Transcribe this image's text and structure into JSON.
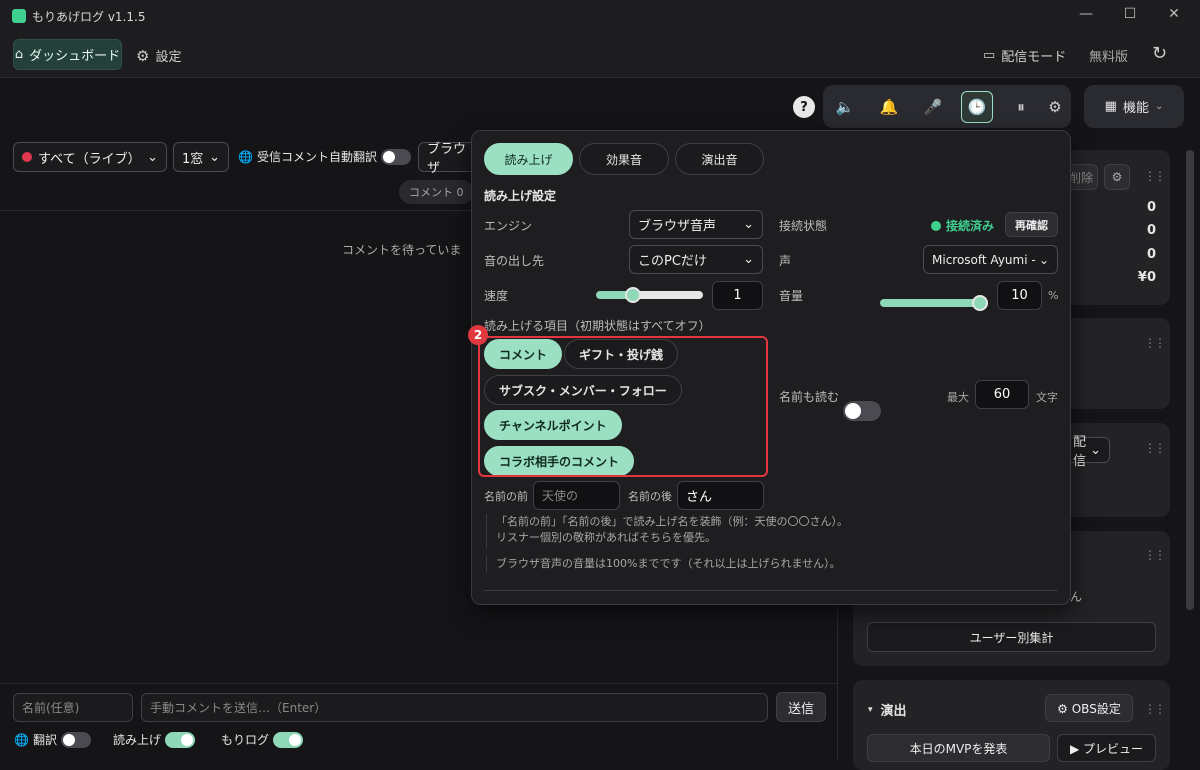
{
  "app": {
    "title": "もりあげログ  v1.1.5"
  },
  "nav": {
    "dashboard": "ダッシュボード",
    "settings": "設定",
    "stream_mode": "配信モード",
    "free_plan": "無料版"
  },
  "toolbar": {
    "help": "?",
    "features": "機能"
  },
  "filters": {
    "source": "すべて（ライブ）",
    "window": "1窓",
    "auto_translate": "受信コメント自動翻訳",
    "auto_translate_on": false,
    "browser_select": "ブラウザ",
    "comment_count": "コメント 0"
  },
  "comments": {
    "empty": "コメントを待っていま"
  },
  "bottom": {
    "name_placeholder": "名前(任意)",
    "comment_placeholder": "手動コメントを送信…（Enter）",
    "send": "送信",
    "translate_label": "翻訳",
    "translate_on": false,
    "read_label": "読み上げ",
    "read_on": true,
    "morilog_label": "もりログ",
    "morilog_on": true
  },
  "right_cards": {
    "delete_partial": "削除",
    "stats": [
      "0",
      "0",
      "0",
      "¥0"
    ],
    "haishin_partial": "配信",
    "san_partial": "ん",
    "user_stats": "ユーザー別集計",
    "effects_title": "演出",
    "obs_settings": "⚙ OBS設定",
    "mvp": "本日のMVPを発表",
    "preview": "▶ プレビュー"
  },
  "popup": {
    "tabs": [
      "読み上げ",
      "効果音",
      "演出音"
    ],
    "active_tab": 0,
    "section_title": "読み上げ設定",
    "engine_label": "エンジン",
    "engine_value": "ブラウザ音声",
    "output_label": "音の出し先",
    "output_value": "このPCだけ",
    "speed_label": "速度",
    "speed_value": "1",
    "speed_level": 0.35,
    "connection_label": "接続状態",
    "connection_value": "接続済み",
    "recheck": "再確認",
    "voice_label": "声",
    "voice_value": "Microsoft Ayumi -",
    "volume_label": "音量",
    "volume_value": "10",
    "volume_unit": "%",
    "volume_level": 1.0,
    "items_label": "読み上げる項目（初期状態はすべてオフ）",
    "badge": "2",
    "chips": [
      {
        "label": "コメント",
        "on": true
      },
      {
        "label": "ギフト・投げ銭",
        "on": false
      },
      {
        "label": "サブスク・メンバー・フォロー",
        "on": false
      },
      {
        "label": "チャンネルポイント",
        "on": true
      },
      {
        "label": "コラボ相手のコメント",
        "on": true
      }
    ],
    "read_name_label": "名前も読む",
    "read_name_on": false,
    "max_label": "最大",
    "max_value": "60",
    "max_unit": "文字",
    "name_before_label": "名前の前",
    "name_before_placeholder": "天使の",
    "name_after_label": "名前の後",
    "name_after_value": "さん",
    "note1a": "「名前の前」「名前の後」で読み上げ名を装飾（例：天使の〇〇さん）。",
    "note1b": "リスナー個別の敬称があればそちらを優先。",
    "note2": "ブラウザ音声の音量は100%までです（それ以上は上げられません）。"
  },
  "colors": {
    "accent": "#9be0c3",
    "highlight": "#e0383e",
    "connected": "#3fcf8e",
    "live_dot": "#e0384e"
  }
}
